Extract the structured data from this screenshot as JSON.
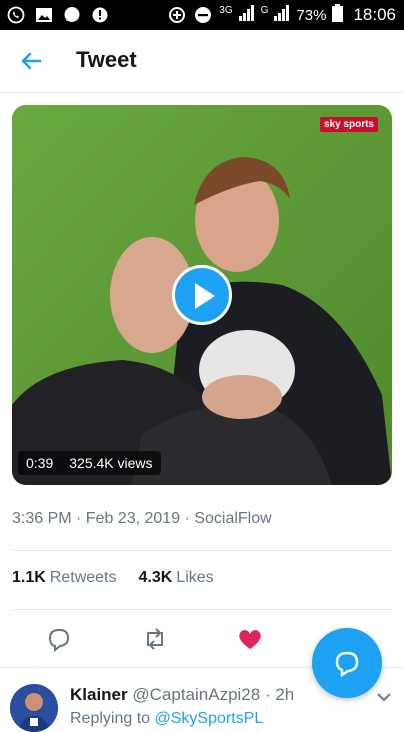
{
  "status_bar": {
    "network_3g": "3G",
    "network_g": "G",
    "battery": "73%",
    "time": "18:06"
  },
  "header": {
    "title": "Tweet"
  },
  "video": {
    "channel_badge": "sky sports",
    "duration": "0:39",
    "views": "325.4K views"
  },
  "tweet": {
    "meta": "3:36 PM · Feb 23, 2019 · SocialFlow",
    "retweets_count": "1.1K",
    "retweets_label": "Retweets",
    "likes_count": "4.3K",
    "likes_label": "Likes",
    "liked": true,
    "like_color": "#e0245e"
  },
  "reply": {
    "name": "Klainer",
    "handle": "@CaptainAzpi28",
    "time": "· 2h",
    "replying_prefix": "Replying to ",
    "replying_to": "@SkySportsPL"
  },
  "colors": {
    "accent": "#1da1f2",
    "muted": "#657786"
  }
}
